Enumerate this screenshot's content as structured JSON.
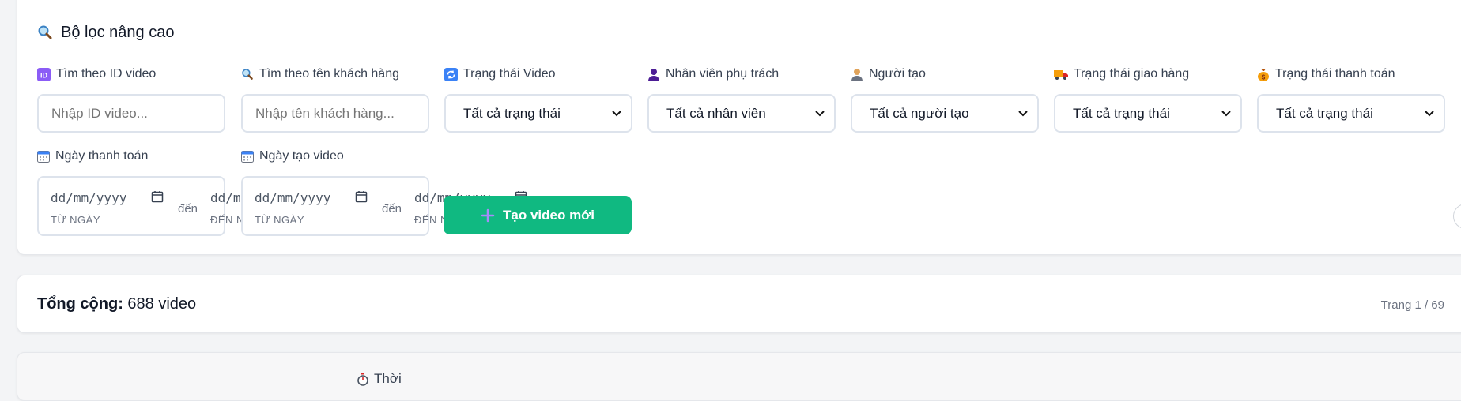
{
  "filter": {
    "title": "Bộ lọc nâng cao",
    "title_icon": "magnifier-icon",
    "fields": {
      "video_id": {
        "label": "Tìm theo ID video",
        "icon": "id-icon",
        "placeholder": "Nhập ID video..."
      },
      "customer": {
        "label": "Tìm theo tên khách hàng",
        "icon": "magnifier-icon",
        "placeholder": "Nhập tên khách hàng..."
      },
      "video_status": {
        "label": "Trạng thái Video",
        "icon": "refresh-icon",
        "value": "Tất cả trạng thái"
      },
      "staff": {
        "label": "Nhân viên phụ trách",
        "icon": "person-icon",
        "value": "Tất cả nhân viên"
      },
      "creator": {
        "label": "Người tạo",
        "icon": "person-icon",
        "value": "Tất cả người tạo"
      },
      "delivery_status": {
        "label": "Trạng thái giao hàng",
        "icon": "truck-icon",
        "value": "Tất cả trạng thái"
      },
      "payment_status": {
        "label": "Trạng thái thanh toán",
        "icon": "money-bag-icon",
        "value": "Tất cả trạng thái"
      }
    },
    "dates": {
      "payment": {
        "label": "Ngày thanh toán",
        "icon": "calendar-icon",
        "from_value": "dd/mm/yyyy",
        "from_caption": "TỪ NGÀY",
        "separator": "đến",
        "to_value": "dd/m",
        "to_caption": "ĐẾN N"
      },
      "created": {
        "label": "Ngày tạo video",
        "icon": "calendar-icon",
        "from_value": "dd/mm/yyyy",
        "from_caption": "TỪ NGÀY",
        "separator": "đến",
        "to_value": "dd/mm/yyyy",
        "to_caption": "ĐẾN NGÀY"
      }
    },
    "create_button": {
      "label": "Tạo video mới",
      "icon": "plus-icon"
    }
  },
  "summary": {
    "total_label": "Tổng cộng:",
    "total_value": "688 video",
    "page_info": "Trang 1 / 69"
  },
  "table": {
    "partial_header": "Thời",
    "partial_header_icon": "stopwatch-icon"
  },
  "colors": {
    "accent_green": "#10b981",
    "border": "#dde3ec",
    "background": "#f3f4f6"
  }
}
